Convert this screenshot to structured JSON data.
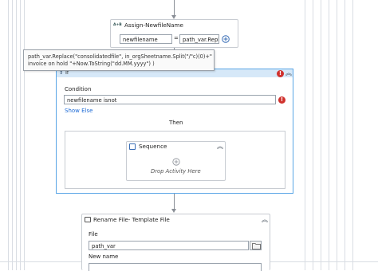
{
  "assign": {
    "icon": "assign-icon",
    "icon_text": "A+B",
    "title": "Assign-NewfileName",
    "to_value": "newfilename",
    "equals": "=",
    "value": "path_var.Repla",
    "add_icon": "plus-circle-icon"
  },
  "tooltip": {
    "line1": "path_var.Replace(\"consolidatedfile\", in_orgSheetname.Split(\"/\"c)(0)+\"",
    "line2": "invoice on hold \"+Now.ToString(\"dd.MM.yyyy\") )"
  },
  "if_activity": {
    "title": "If",
    "condition_label": "Condition",
    "condition_value": "newfilename isnot",
    "show_else": "Show Else",
    "then_label": "Then",
    "error_mark": "!"
  },
  "sequence": {
    "title": "Sequence",
    "drop_text": "Drop Activity Here"
  },
  "rename_file": {
    "title": "Rename File- Template File",
    "file_label": "File",
    "file_value": "path_var",
    "new_name_label": "New name"
  },
  "colors": {
    "selected_border": "#5aa6e6",
    "selected_header": "#d6e8f8",
    "error": "#d0312d",
    "link": "#1e6bd6"
  }
}
